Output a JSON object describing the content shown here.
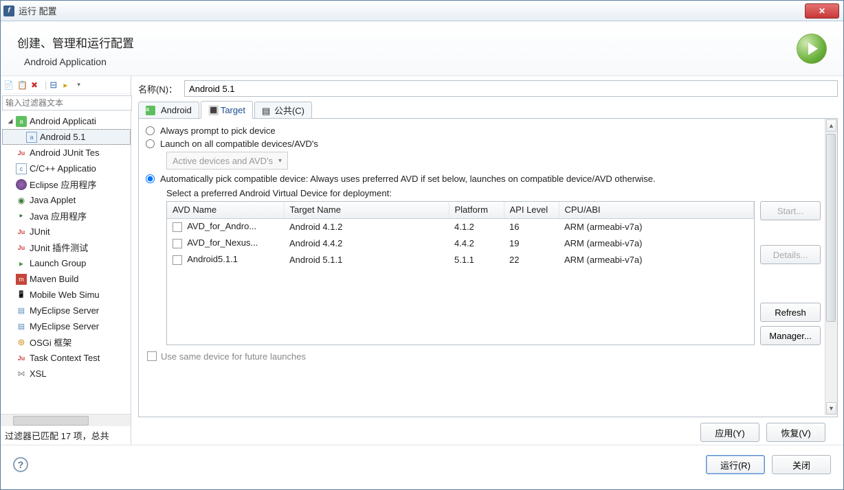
{
  "window_title": "运行 配置",
  "header": {
    "title": "创建、管理和运行配置",
    "sub": "Android Application"
  },
  "filter_placeholder": "输入过滤器文本",
  "tree": [
    {
      "label": "Android Applicati",
      "icon": "t-and",
      "expanded": true,
      "children": [
        {
          "label": "Android 5.1",
          "icon": "t-andapp",
          "selected": true
        }
      ]
    },
    {
      "label": "Android JUnit Tes",
      "icon": "t-ju"
    },
    {
      "label": "C/C++ Applicatio",
      "icon": "t-c"
    },
    {
      "label": "Eclipse 应用程序",
      "icon": "t-ec"
    },
    {
      "label": "Java Applet",
      "icon": "t-ja"
    },
    {
      "label": "Java 应用程序",
      "icon": "t-jv"
    },
    {
      "label": "JUnit",
      "icon": "t-ju"
    },
    {
      "label": "JUnit 插件测试",
      "icon": "t-ju"
    },
    {
      "label": "Launch Group",
      "icon": "t-lg"
    },
    {
      "label": "Maven Build",
      "icon": "t-mv"
    },
    {
      "label": "Mobile Web Simu",
      "icon": "t-mw"
    },
    {
      "label": "MyEclipse Server",
      "icon": "t-my"
    },
    {
      "label": "MyEclipse Server",
      "icon": "t-my"
    },
    {
      "label": "OSGi 框架",
      "icon": "t-os"
    },
    {
      "label": "Task Context Test",
      "icon": "t-ju"
    },
    {
      "label": "XSL",
      "icon": "t-xsl"
    }
  ],
  "status": "过滤器已匹配 17 项，总共",
  "name_label": "名称(N)：",
  "name_value": "Android 5.1",
  "tabs": {
    "android": "Android",
    "target": "Target",
    "common": "公共(C)"
  },
  "radios": {
    "always": "Always prompt to pick device",
    "launch": "Launch on all compatible devices/AVD's",
    "auto": "Automatically pick compatible device: Always uses preferred AVD if set below, launches on compatible device/AVD otherwise."
  },
  "combo_label": "Active devices and AVD's",
  "avd_label": "Select a preferred Android Virtual Device for deployment:",
  "table": {
    "cols": {
      "avd": "AVD Name",
      "target": "Target Name",
      "platform": "Platform",
      "api": "API Level",
      "cpu": "CPU/ABI"
    },
    "rows": [
      {
        "avd": "AVD_for_Andro...",
        "target": "Android 4.1.2",
        "platform": "4.1.2",
        "api": "16",
        "cpu": "ARM (armeabi-v7a)"
      },
      {
        "avd": "AVD_for_Nexus...",
        "target": "Android 4.4.2",
        "platform": "4.4.2",
        "api": "19",
        "cpu": "ARM (armeabi-v7a)"
      },
      {
        "avd": "Android5.1.1",
        "target": "Android 5.1.1",
        "platform": "5.1.1",
        "api": "22",
        "cpu": "ARM (armeabi-v7a)"
      }
    ]
  },
  "buttons": {
    "start": "Start...",
    "details": "Details...",
    "refresh": "Refresh",
    "manager": "Manager..."
  },
  "checkbox_cut": "Use same device for future launches",
  "apply": "应用(Y)",
  "revert": "恢复(V)",
  "run": "运行(R)",
  "close": "关闭"
}
